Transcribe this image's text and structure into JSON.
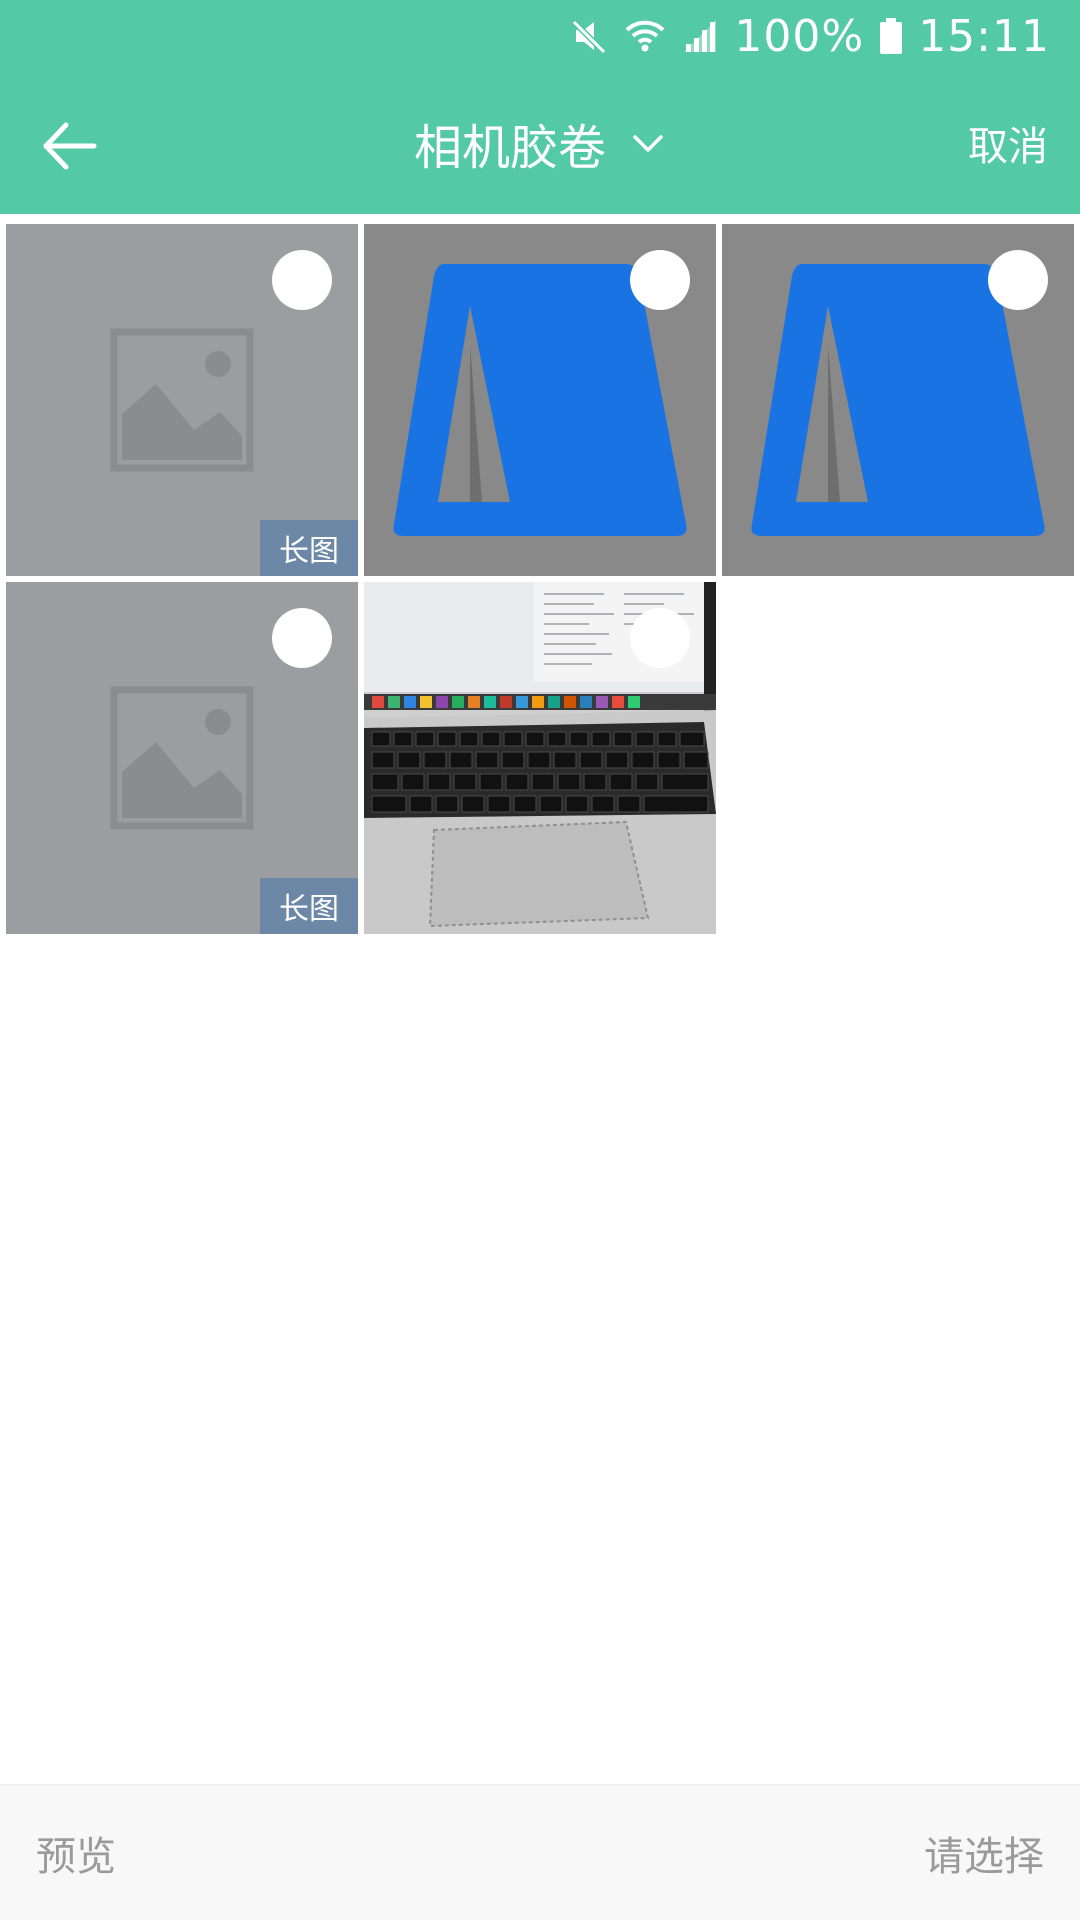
{
  "status_bar": {
    "battery_percent": "100%",
    "time": "15:11",
    "icons": [
      "mute-icon",
      "wifi-icon",
      "signal-icon",
      "battery-icon"
    ]
  },
  "header": {
    "title": "相机胶卷",
    "cancel_label": "取消",
    "icons": [
      "back-arrow-icon",
      "chevron-down-icon"
    ]
  },
  "grid": {
    "items": [
      {
        "kind": "placeholder",
        "badge": "长图"
      },
      {
        "kind": "tent-graphic",
        "badge": ""
      },
      {
        "kind": "tent-graphic",
        "badge": ""
      },
      {
        "kind": "placeholder",
        "badge": "长图"
      },
      {
        "kind": "laptop-photo",
        "badge": ""
      }
    ]
  },
  "bottom_bar": {
    "preview_label": "预览",
    "confirm_label": "请选择"
  },
  "colors": {
    "accent": "#53c9a4",
    "badge": "#6d87a6",
    "placeholder": "#9b9da1",
    "tent_blue": "#1a73e3",
    "muted_text": "#9a9a9a"
  }
}
